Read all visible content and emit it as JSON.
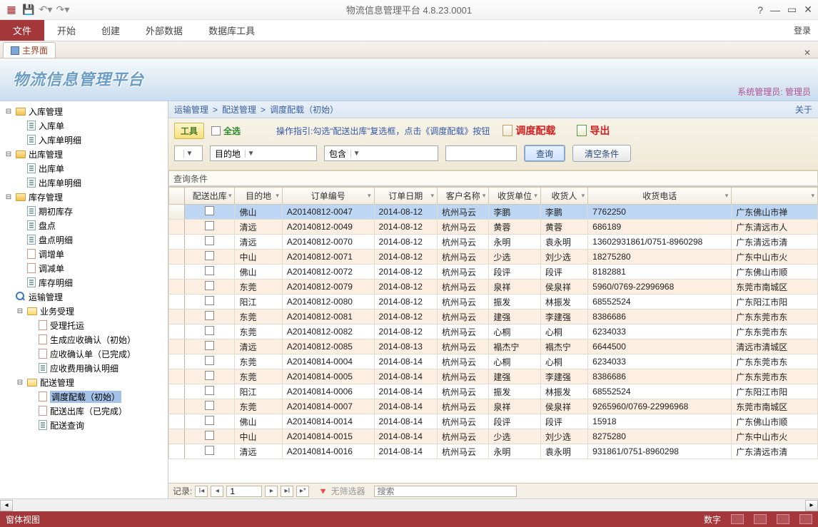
{
  "app": {
    "title": "物流信息管理平台 4.8.23.0001"
  },
  "ribbon": {
    "file": "文件",
    "tabs": [
      "开始",
      "创建",
      "外部数据",
      "数据库工具"
    ],
    "login": "登录"
  },
  "subtab": {
    "label": "主界面"
  },
  "banner": {
    "logo": "物流信息管理平台",
    "mgr_label": "系统管理员:",
    "mgr_value": "管理员"
  },
  "tree": [
    {
      "d": 0,
      "exp": "⊟",
      "ico": "folder",
      "label": "入库管理"
    },
    {
      "d": 1,
      "exp": "",
      "ico": "doc",
      "label": "入库单"
    },
    {
      "d": 1,
      "exp": "",
      "ico": "doc",
      "label": "入库单明细"
    },
    {
      "d": 0,
      "exp": "⊟",
      "ico": "folder",
      "label": "出库管理"
    },
    {
      "d": 1,
      "exp": "",
      "ico": "doc",
      "label": "出库单"
    },
    {
      "d": 1,
      "exp": "",
      "ico": "doc",
      "label": "出库单明细"
    },
    {
      "d": 0,
      "exp": "⊟",
      "ico": "folder",
      "label": "库存管理"
    },
    {
      "d": 1,
      "exp": "",
      "ico": "doc",
      "label": "期初库存"
    },
    {
      "d": 1,
      "exp": "",
      "ico": "doc",
      "label": "盘点"
    },
    {
      "d": 1,
      "exp": "",
      "ico": "doc",
      "label": "盘点明细"
    },
    {
      "d": 1,
      "exp": "",
      "ico": "doc-edit",
      "label": "调增单"
    },
    {
      "d": 1,
      "exp": "",
      "ico": "doc-edit",
      "label": "调减单"
    },
    {
      "d": 1,
      "exp": "",
      "ico": "doc",
      "label": "库存明细"
    },
    {
      "d": 0,
      "exp": "",
      "ico": "search",
      "label": "运输管理",
      "group": true
    },
    {
      "d": 1,
      "exp": "⊟",
      "ico": "folder-open",
      "label": "业务受理"
    },
    {
      "d": 2,
      "exp": "",
      "ico": "doc-edit",
      "label": "受理托运"
    },
    {
      "d": 2,
      "exp": "",
      "ico": "doc-edit",
      "label": "生成应收确认（初始）"
    },
    {
      "d": 2,
      "exp": "",
      "ico": "doc-edit",
      "label": "应收确认单（已完成）"
    },
    {
      "d": 2,
      "exp": "",
      "ico": "doc",
      "label": "应收费用确认明细"
    },
    {
      "d": 1,
      "exp": "⊟",
      "ico": "folder-open",
      "label": "配送管理"
    },
    {
      "d": 2,
      "exp": "",
      "ico": "doc-edit",
      "label": "调度配载（初始）",
      "selected": true
    },
    {
      "d": 2,
      "exp": "",
      "ico": "doc-edit",
      "label": "配送出库（已完成）"
    },
    {
      "d": 2,
      "exp": "",
      "ico": "doc",
      "label": "配送查询"
    }
  ],
  "breadcrumb": {
    "items": [
      "运输管理",
      "配送管理",
      "调度配载（初始）"
    ],
    "about": "关于"
  },
  "toolbar": {
    "tool_btn": "工具",
    "select_all": "全选",
    "hint": "操作指引:勾选“配送出库”复选框，点击《调度配载》按钮",
    "action1": "调度配载",
    "action2": "导出",
    "field_combo": "目的地",
    "op_combo": "包含",
    "query_btn": "查询",
    "clear_btn": "清空条件",
    "query_cond_label": "查询条件"
  },
  "grid": {
    "columns": [
      "配送出库",
      "目的地",
      "订单编号",
      "订单日期",
      "客户名称",
      "收货单位",
      "收货人",
      "收货电话",
      ""
    ],
    "rows": [
      {
        "sel": true,
        "dest": "佛山",
        "ord": "A20140812-0047",
        "date": "2014-08-12",
        "cust": "杭州马云",
        "unit": "李鹏",
        "recv": "李鹏",
        "tel": "7762250",
        "addr": "广东佛山市禅"
      },
      {
        "dest": "清远",
        "ord": "A20140812-0049",
        "date": "2014-08-12",
        "cust": "杭州马云",
        "unit": "黄蓉",
        "recv": "黄蓉",
        "tel": "686189",
        "addr": "广东清远市人"
      },
      {
        "dest": "清远",
        "ord": "A20140812-0070",
        "date": "2014-08-12",
        "cust": "杭州马云",
        "unit": "永明",
        "recv": "袁永明",
        "tel": "13602931861/0751-8960298",
        "addr": "广东清远市清"
      },
      {
        "dest": "中山",
        "ord": "A20140812-0071",
        "date": "2014-08-12",
        "cust": "杭州马云",
        "unit": "少选",
        "recv": "刘少选",
        "tel": "18275280",
        "addr": "广东中山市火"
      },
      {
        "dest": "佛山",
        "ord": "A20140812-0072",
        "date": "2014-08-12",
        "cust": "杭州马云",
        "unit": "段评",
        "recv": "段评",
        "tel": "8182881",
        "addr": "广东佛山市顺"
      },
      {
        "dest": "东莞",
        "ord": "A20140812-0079",
        "date": "2014-08-12",
        "cust": "杭州马云",
        "unit": "泉祥",
        "recv": "侯泉祥",
        "tel": "5960/0769-22996968",
        "addr": "东莞市南城区"
      },
      {
        "dest": "阳江",
        "ord": "A20140812-0080",
        "date": "2014-08-12",
        "cust": "杭州马云",
        "unit": "振发",
        "recv": "林振发",
        "tel": "68552524",
        "addr": "广东阳江市阳"
      },
      {
        "dest": "东莞",
        "ord": "A20140812-0081",
        "date": "2014-08-12",
        "cust": "杭州马云",
        "unit": "建强",
        "recv": "李建强",
        "tel": "8386686",
        "addr": "广东东莞市东"
      },
      {
        "dest": "东莞",
        "ord": "A20140812-0082",
        "date": "2014-08-12",
        "cust": "杭州马云",
        "unit": "心桐",
        "recv": "心桐",
        "tel": "6234033",
        "addr": "广东东莞市东"
      },
      {
        "dest": "清远",
        "ord": "A20140812-0085",
        "date": "2014-08-13",
        "cust": "杭州马云",
        "unit": "褟杰宁",
        "recv": "褟杰宁",
        "tel": "6644500",
        "addr": "清远市清城区"
      },
      {
        "dest": "东莞",
        "ord": "A20140814-0004",
        "date": "2014-08-14",
        "cust": "杭州马云",
        "unit": "心桐",
        "recv": "心桐",
        "tel": "6234033",
        "addr": "广东东莞市东"
      },
      {
        "dest": "东莞",
        "ord": "A20140814-0005",
        "date": "2014-08-14",
        "cust": "杭州马云",
        "unit": "建强",
        "recv": "李建强",
        "tel": "8386686",
        "addr": "广东东莞市东"
      },
      {
        "dest": "阳江",
        "ord": "A20140814-0006",
        "date": "2014-08-14",
        "cust": "杭州马云",
        "unit": "振发",
        "recv": "林振发",
        "tel": "68552524",
        "addr": "广东阳江市阳"
      },
      {
        "dest": "东莞",
        "ord": "A20140814-0007",
        "date": "2014-08-14",
        "cust": "杭州马云",
        "unit": "泉祥",
        "recv": "侯泉祥",
        "tel": "9265960/0769-22996968",
        "addr": "东莞市南城区"
      },
      {
        "dest": "佛山",
        "ord": "A20140814-0014",
        "date": "2014-08-14",
        "cust": "杭州马云",
        "unit": "段评",
        "recv": "段评",
        "tel": "15918",
        "addr": "广东佛山市顺"
      },
      {
        "dest": "中山",
        "ord": "A20140814-0015",
        "date": "2014-08-14",
        "cust": "杭州马云",
        "unit": "少选",
        "recv": "刘少选",
        "tel": "8275280",
        "addr": "广东中山市火"
      },
      {
        "dest": "清远",
        "ord": "A20140814-0016",
        "date": "2014-08-14",
        "cust": "杭州马云",
        "unit": "永明",
        "recv": "袁永明",
        "tel": "931861/0751-8960298",
        "addr": "广东清远市清"
      }
    ]
  },
  "recnav": {
    "label": "记录:",
    "pos": "1",
    "nofilter": "无筛选器",
    "search_ph": "搜索"
  },
  "status": {
    "left": "窗体视图",
    "right": "数字"
  }
}
